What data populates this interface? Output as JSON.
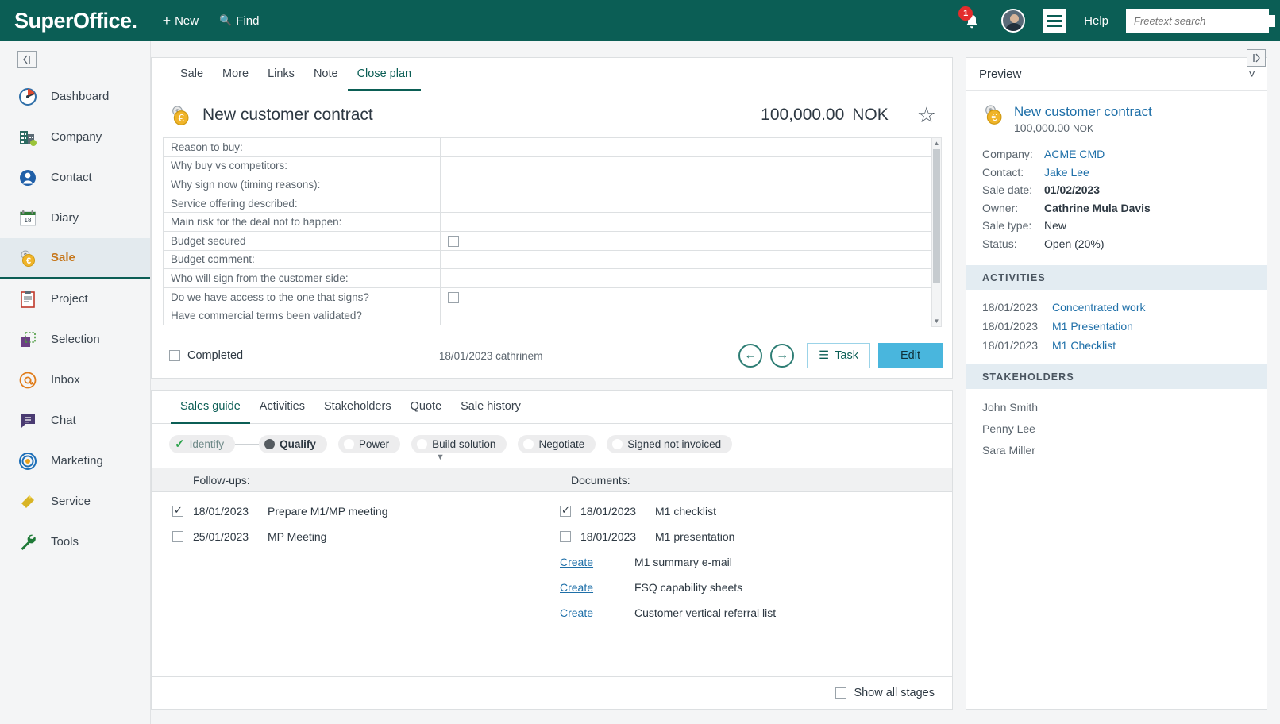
{
  "topbar": {
    "logo": "SuperOffice",
    "logo_dot": ".",
    "new_label": "New",
    "find_label": "Find",
    "notification_count": "1",
    "help_label": "Help",
    "search_placeholder": "Freetext search",
    "search_value": "",
    "brand_color": "#0b5e55",
    "badge_color": "#e32c2c"
  },
  "sidebar": {
    "collapse_icon": "◀|",
    "items": [
      {
        "label": "Dashboard",
        "icon": "gauge-icon",
        "active": false
      },
      {
        "label": "Company",
        "icon": "building-icon",
        "active": false
      },
      {
        "label": "Contact",
        "icon": "person-icon",
        "active": false
      },
      {
        "label": "Diary",
        "icon": "calendar-icon",
        "active": false
      },
      {
        "label": "Sale",
        "icon": "coin-icon",
        "active": true
      },
      {
        "label": "Project",
        "icon": "clipboard-icon",
        "active": false
      },
      {
        "label": "Selection",
        "icon": "selection-icon",
        "active": false
      },
      {
        "label": "Inbox",
        "icon": "at-icon",
        "active": false
      },
      {
        "label": "Chat",
        "icon": "chat-bubble-icon",
        "active": false
      },
      {
        "label": "Marketing",
        "icon": "target-icon",
        "active": false
      },
      {
        "label": "Service",
        "icon": "ticket-icon",
        "active": false
      },
      {
        "label": "Tools",
        "icon": "wrench-icon",
        "active": false
      }
    ],
    "active_color": "#c6771c"
  },
  "sale_card": {
    "tabs": [
      {
        "label": "Sale",
        "active": false
      },
      {
        "label": "More",
        "active": false
      },
      {
        "label": "Links",
        "active": false
      },
      {
        "label": "Note",
        "active": false
      },
      {
        "label": "Close plan",
        "active": true
      }
    ],
    "title": "New customer contract",
    "amount": "100,000.00",
    "currency": "NOK",
    "star_icon": "☆",
    "close_plan_rows": [
      {
        "label": "Reason to buy:",
        "type": "text",
        "value": ""
      },
      {
        "label": "Why buy  vs competitors:",
        "type": "text",
        "value": ""
      },
      {
        "label": "Why sign now (timing reasons):",
        "type": "text",
        "value": ""
      },
      {
        "label": "Service offering described:",
        "type": "text",
        "value": ""
      },
      {
        "label": "Main risk for the deal not to happen:",
        "type": "text",
        "value": ""
      },
      {
        "label": "Budget secured",
        "type": "checkbox",
        "checked": false
      },
      {
        "label": "Budget comment:",
        "type": "text",
        "value": ""
      },
      {
        "label": "Who will sign from the customer side:",
        "type": "text",
        "value": ""
      },
      {
        "label": "Do we have access to the one that signs?",
        "type": "checkbox",
        "checked": false
      },
      {
        "label": "Have commercial terms been validated?",
        "type": "text",
        "value": ""
      }
    ],
    "footer": {
      "completed_label": "Completed",
      "completed_checked": false,
      "stamp": "18/01/2023 cathrinem",
      "prev_icon": "←",
      "next_icon": "→",
      "task_label": "Task",
      "task_icon": "☰",
      "edit_label": "Edit"
    }
  },
  "guide_card": {
    "tabs": [
      {
        "label": "Sales guide",
        "active": true
      },
      {
        "label": "Activities",
        "active": false
      },
      {
        "label": "Stakeholders",
        "active": false
      },
      {
        "label": "Quote",
        "active": false
      },
      {
        "label": "Sale history",
        "active": false
      }
    ],
    "stages": [
      {
        "label": "Identify",
        "state": "done"
      },
      {
        "label": "Qualify",
        "state": "current"
      },
      {
        "label": "Power",
        "state": "todo"
      },
      {
        "label": "Build solution",
        "state": "todo"
      },
      {
        "label": "Negotiate",
        "state": "todo"
      },
      {
        "label": "Signed not invoiced",
        "state": "todo"
      }
    ],
    "followups_header": "Follow-ups:",
    "documents_header": "Documents:",
    "followups": [
      {
        "checked": true,
        "date": "18/01/2023",
        "label": "Prepare M1/MP meeting"
      },
      {
        "checked": false,
        "date": "25/01/2023",
        "label": "MP Meeting"
      }
    ],
    "documents": [
      {
        "kind": "checkbox",
        "checked": true,
        "date": "18/01/2023",
        "label": "M1 checklist"
      },
      {
        "kind": "checkbox",
        "checked": false,
        "date": "18/01/2023",
        "label": "M1 presentation"
      },
      {
        "kind": "create",
        "create_label": "Create",
        "label": "M1 summary e-mail"
      },
      {
        "kind": "create",
        "create_label": "Create",
        "label": "FSQ capability sheets"
      },
      {
        "kind": "create",
        "create_label": "Create",
        "label": "Customer vertical referral list"
      }
    ],
    "show_all_stages_label": "Show all stages",
    "show_all_stages_checked": false
  },
  "preview": {
    "expand_icon": "|▶",
    "header": "Preview",
    "chevron": "⌄",
    "title": "New customer contract",
    "amount": "100,000.00",
    "currency": "NOK",
    "fields": [
      {
        "key": "Company:",
        "value": "ACME CMD",
        "style": "link"
      },
      {
        "key": "Contact:",
        "value": "Jake Lee",
        "style": "link"
      },
      {
        "key": "Sale date:",
        "value": "01/02/2023",
        "style": "bold"
      },
      {
        "key": "Owner:",
        "value": "Cathrine Mula Davis",
        "style": "bold"
      },
      {
        "key": "Sale type:",
        "value": "New",
        "style": "plain"
      },
      {
        "key": "Status:",
        "value": "Open (20%)",
        "style": "plain"
      }
    ],
    "activities_header": "ACTIVITIES",
    "activities": [
      {
        "date": "18/01/2023",
        "title": "Concentrated work"
      },
      {
        "date": "18/01/2023",
        "title": "M1 Presentation"
      },
      {
        "date": "18/01/2023",
        "title": "M1 Checklist"
      }
    ],
    "stakeholders_header": "STAKEHOLDERS",
    "stakeholders": [
      "John Smith",
      "Penny Lee",
      "Sara Miller"
    ]
  }
}
